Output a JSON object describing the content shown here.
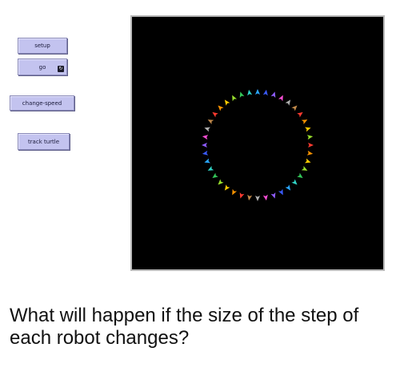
{
  "controls": {
    "setup_label": "setup",
    "go_label": "go",
    "go_forever_icon": "forever-icon",
    "change_speed_label": "change-speed",
    "track_turtle_label": "track turtle"
  },
  "world": {
    "background_color": "#000000",
    "turtle_count": 40,
    "turtle_shape": "arrow-icon",
    "turtle_colors": [
      "#ff3b30",
      "#ff9500",
      "#ffcc00",
      "#9be22d",
      "#34c759",
      "#30d5c8",
      "#2aa7ff",
      "#3a5bff",
      "#8e5cff",
      "#ff4fd8",
      "#b0b0b0",
      "#c28a4a"
    ]
  },
  "question": "What will happen if the size of the step of each robot changes?"
}
